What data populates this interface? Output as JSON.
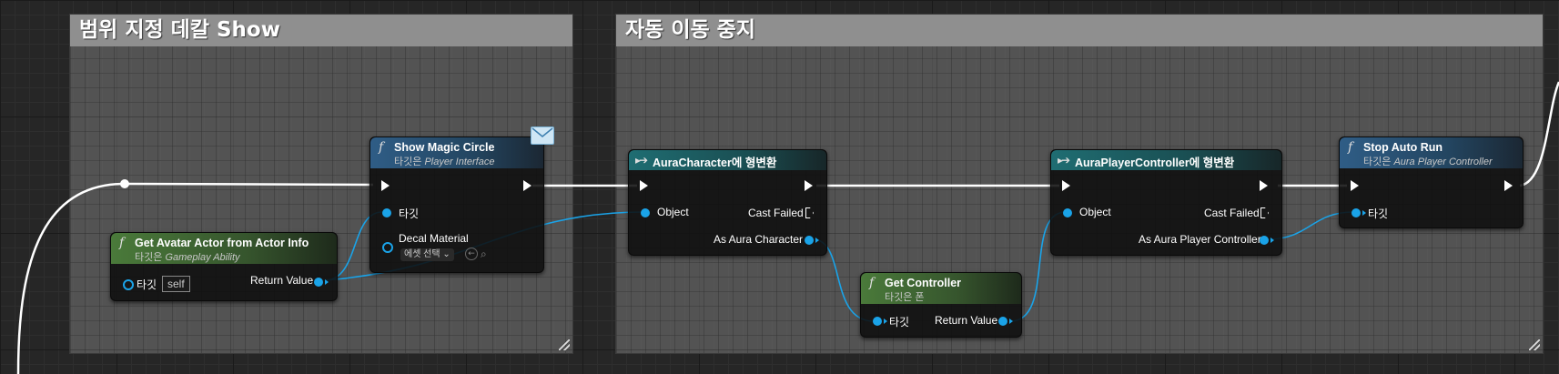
{
  "comments": {
    "left_title": "범위 지정 데칼 Show",
    "right_title": "자동 이동 중지"
  },
  "nodes": {
    "get_avatar": {
      "title": "Get Avatar Actor from Actor Info",
      "subtitle_prefix": "타깃은",
      "subtitle_target": "Gameplay Ability",
      "pin_target": "타깃",
      "self_value": "self",
      "pin_return": "Return Value"
    },
    "show_magic": {
      "title": "Show Magic Circle",
      "subtitle_prefix": "타깃은",
      "subtitle_target": "Player Interface",
      "pin_target": "타깃",
      "pin_decal": "Decal Material",
      "asset_select": "에셋 선택"
    },
    "cast_aura_char": {
      "title": "AuraCharacter에 형변환",
      "pin_object": "Object",
      "pin_cast_failed": "Cast Failed",
      "pin_as": "As Aura Character"
    },
    "get_controller": {
      "title": "Get Controller",
      "subtitle": "타깃은 폰",
      "pin_target": "타깃",
      "pin_return": "Return Value"
    },
    "cast_aura_pc": {
      "title": "AuraPlayerController에 형변환",
      "pin_object": "Object",
      "pin_cast_failed": "Cast Failed",
      "pin_as": "As Aura Player Controller"
    },
    "stop_auto_run": {
      "title": "Stop Auto Run",
      "subtitle_prefix": "타깃은",
      "subtitle_target": "Aura Player Controller",
      "pin_target": "타깃"
    }
  },
  "icons": {
    "function": "function-icon",
    "cast": "cast-icon",
    "message": "message-envelope-icon",
    "search": "search-icon",
    "browse": "browse-arrow-icon"
  },
  "colors": {
    "exec_wire": "#ffffff",
    "object_wire": "#1aa3e8",
    "function_header": "#2f5d86",
    "pure_header": "#4a7a3a",
    "cast_header": "#1f6d72"
  }
}
